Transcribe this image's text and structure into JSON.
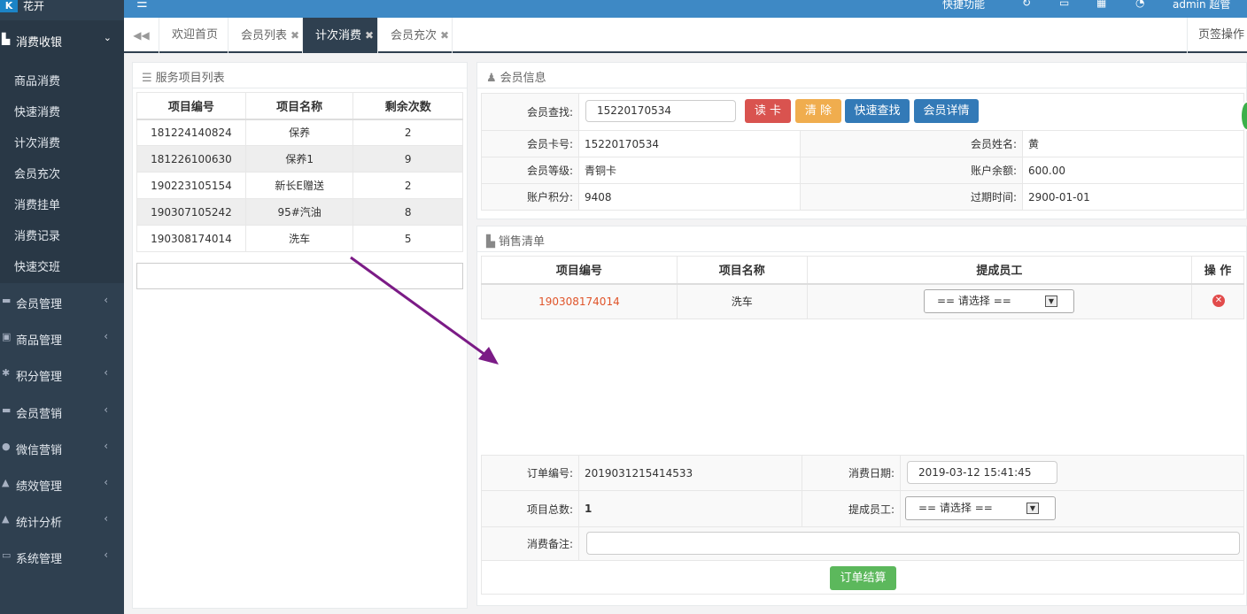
{
  "app": {
    "logo_mark": "K",
    "logo_text": "花开"
  },
  "sidebar": {
    "active": {
      "label": "消费收银"
    },
    "subitems": [
      "商品消费",
      "快速消费",
      "计次消费",
      "会员充次",
      "消费挂单",
      "消费记录",
      "快速交班"
    ],
    "items": [
      {
        "label": "会员管理"
      },
      {
        "label": "商品管理"
      },
      {
        "label": "积分管理"
      },
      {
        "label": "会员营销"
      },
      {
        "label": "微信营销"
      },
      {
        "label": "绩效管理"
      },
      {
        "label": "统计分析"
      },
      {
        "label": "系统管理"
      }
    ]
  },
  "topbar": {
    "shortcut": "快捷功能",
    "user": "admin 超管"
  },
  "tabs": [
    {
      "label": "欢迎首页",
      "closable": false
    },
    {
      "label": "会员列表",
      "closable": true
    },
    {
      "label": "计次消费",
      "closable": true,
      "active": true
    },
    {
      "label": "会员充次",
      "closable": true
    }
  ],
  "page_ops": "页签操作",
  "services": {
    "title": "服务项目列表",
    "headers": [
      "项目编号",
      "项目名称",
      "剩余次数"
    ],
    "rows": [
      [
        "181224140824",
        "保养",
        "2"
      ],
      [
        "181226100630",
        "保养1",
        "9"
      ],
      [
        "190223105154",
        "新长E赠送",
        "2"
      ],
      [
        "190307105242",
        "95#汽油",
        "8"
      ],
      [
        "190308174014",
        "洗车",
        "5"
      ]
    ]
  },
  "member": {
    "title": "会员信息",
    "search_label": "会员查找:",
    "search_value": "15220170534",
    "buttons": {
      "read": "读 卡",
      "clear": "清 除",
      "quick": "快速查找",
      "detail": "会员详情"
    },
    "card_no_label": "会员卡号:",
    "card_no": "15220170534",
    "name_label": "会员姓名:",
    "name": "黄",
    "level_label": "会员等级:",
    "level": "青铜卡",
    "balance_label": "账户余额:",
    "balance": "600.00",
    "points_label": "账户积分:",
    "points": "9408",
    "expire_label": "过期时间:",
    "expire": "2900-01-01"
  },
  "sale": {
    "title": "销售清单",
    "headers": [
      "项目编号",
      "项目名称",
      "提成员工",
      "操 作"
    ],
    "row": {
      "code": "190308174014",
      "name": "洗车",
      "staff": "== 请选择 =="
    }
  },
  "order": {
    "no_label": "订单编号:",
    "no": "2019031215414533",
    "date_label": "消费日期:",
    "date": "2019-03-12 15:41:45",
    "count_label": "项目总数:",
    "count": "1",
    "staff_label": "提成员工:",
    "staff": "== 请选择 ==",
    "note_label": "消费备注:",
    "note": "",
    "submit": "订单结算"
  },
  "colors": {
    "sidebar": "#2f4050",
    "topbar": "#3e89c5",
    "code_red": "#e0552b",
    "arrow": "#7b1b86"
  }
}
